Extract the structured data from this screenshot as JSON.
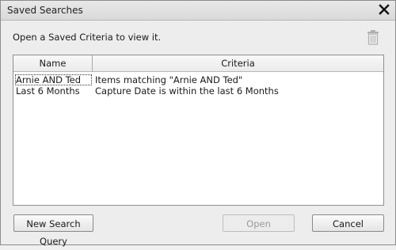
{
  "dialog": {
    "title": "Saved Searches",
    "instruction": "Open a Saved Criteria to view it."
  },
  "table": {
    "headers": {
      "name": "Name",
      "criteria": "Criteria"
    },
    "rows": [
      {
        "name": "Arnie AND Ted",
        "criteria": "Items matching \"Arnie AND Ted\""
      },
      {
        "name": "Last 6 Months",
        "criteria": "Capture Date is within the last 6 Months"
      }
    ]
  },
  "buttons": {
    "new_query": "New Search Query",
    "open": "Open",
    "cancel": "Cancel"
  }
}
